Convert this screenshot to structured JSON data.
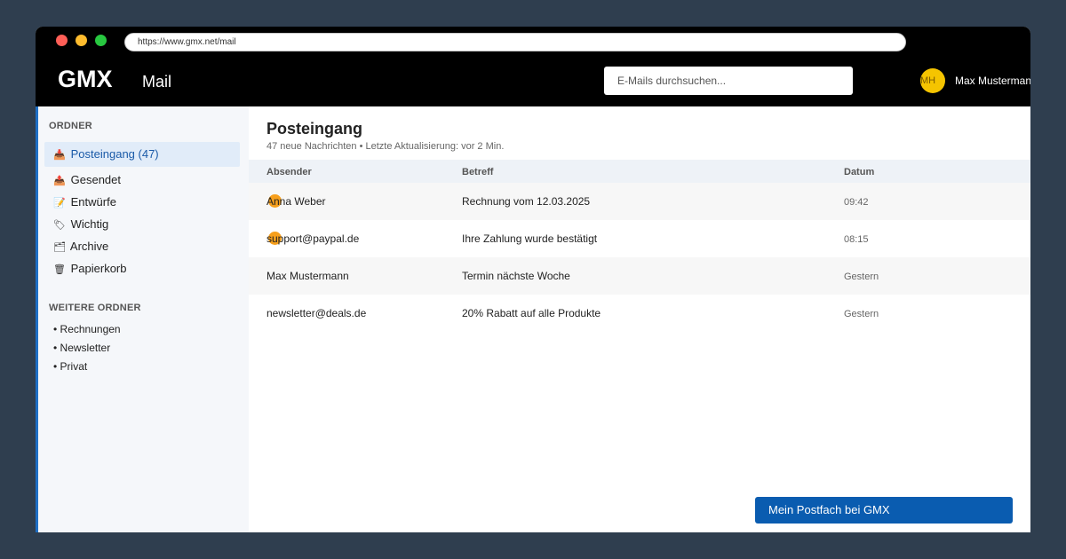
{
  "browser": {
    "url": "https://www.gmx.net/mail"
  },
  "header": {
    "logo": "GMX",
    "app_name": "Mail",
    "search_placeholder": "E-Mails durchsuchen...",
    "user": {
      "initials": "MH",
      "name": "Max Mustermann"
    }
  },
  "sidebar": {
    "folders_title": "ORDNER",
    "folders": [
      {
        "label": "Posteingang (47)",
        "icon": "📥",
        "icon_name": "inbox-icon",
        "active": true
      },
      {
        "label": "Gesendet",
        "icon": "📤",
        "icon_name": "sent-icon",
        "active": false
      },
      {
        "label": "Entwürfe",
        "icon": "📝",
        "icon_name": "drafts-icon",
        "active": false
      },
      {
        "label": "Wichtig",
        "icon": "🏷",
        "icon_name": "important-icon",
        "active": false
      },
      {
        "label": "Archive",
        "icon": "🗂",
        "icon_name": "archive-icon",
        "active": false
      },
      {
        "label": "Papierkorb",
        "icon": "🗑",
        "icon_name": "trash-icon",
        "active": false
      }
    ],
    "more_title": "WEITERE ORDNER",
    "more_folders": [
      "• Rechnungen",
      "• Newsletter",
      "• Privat"
    ]
  },
  "inbox": {
    "title": "Posteingang",
    "meta": "47 neue Nachrichten • Letzte Aktualisierung: vor 2 Min.",
    "columns": {
      "sender": "Absender",
      "subject": "Betreff",
      "date": "Datum"
    },
    "rows": [
      {
        "sender": "Anna Weber",
        "subject": "Rechnung vom 12.03.2025",
        "date": "09:42",
        "unread": true
      },
      {
        "sender": "support@paypal.de",
        "subject": "Ihre Zahlung wurde bestätigt",
        "date": "08:15",
        "unread": true
      },
      {
        "sender": "Max Mustermann",
        "subject": "Termin nächste Woche",
        "date": "Gestern",
        "unread": false
      },
      {
        "sender": "newsletter@deals.de",
        "subject": "20% Rabatt auf alle Produkte",
        "date": "Gestern",
        "unread": false
      }
    ]
  },
  "cta": {
    "label": "Mein Postfach bei GMX"
  },
  "colors": {
    "header_bg": "#000000",
    "accent": "#0a5cb0",
    "unread_marker": "#f59a10",
    "avatar_bg": "#f5c400"
  }
}
